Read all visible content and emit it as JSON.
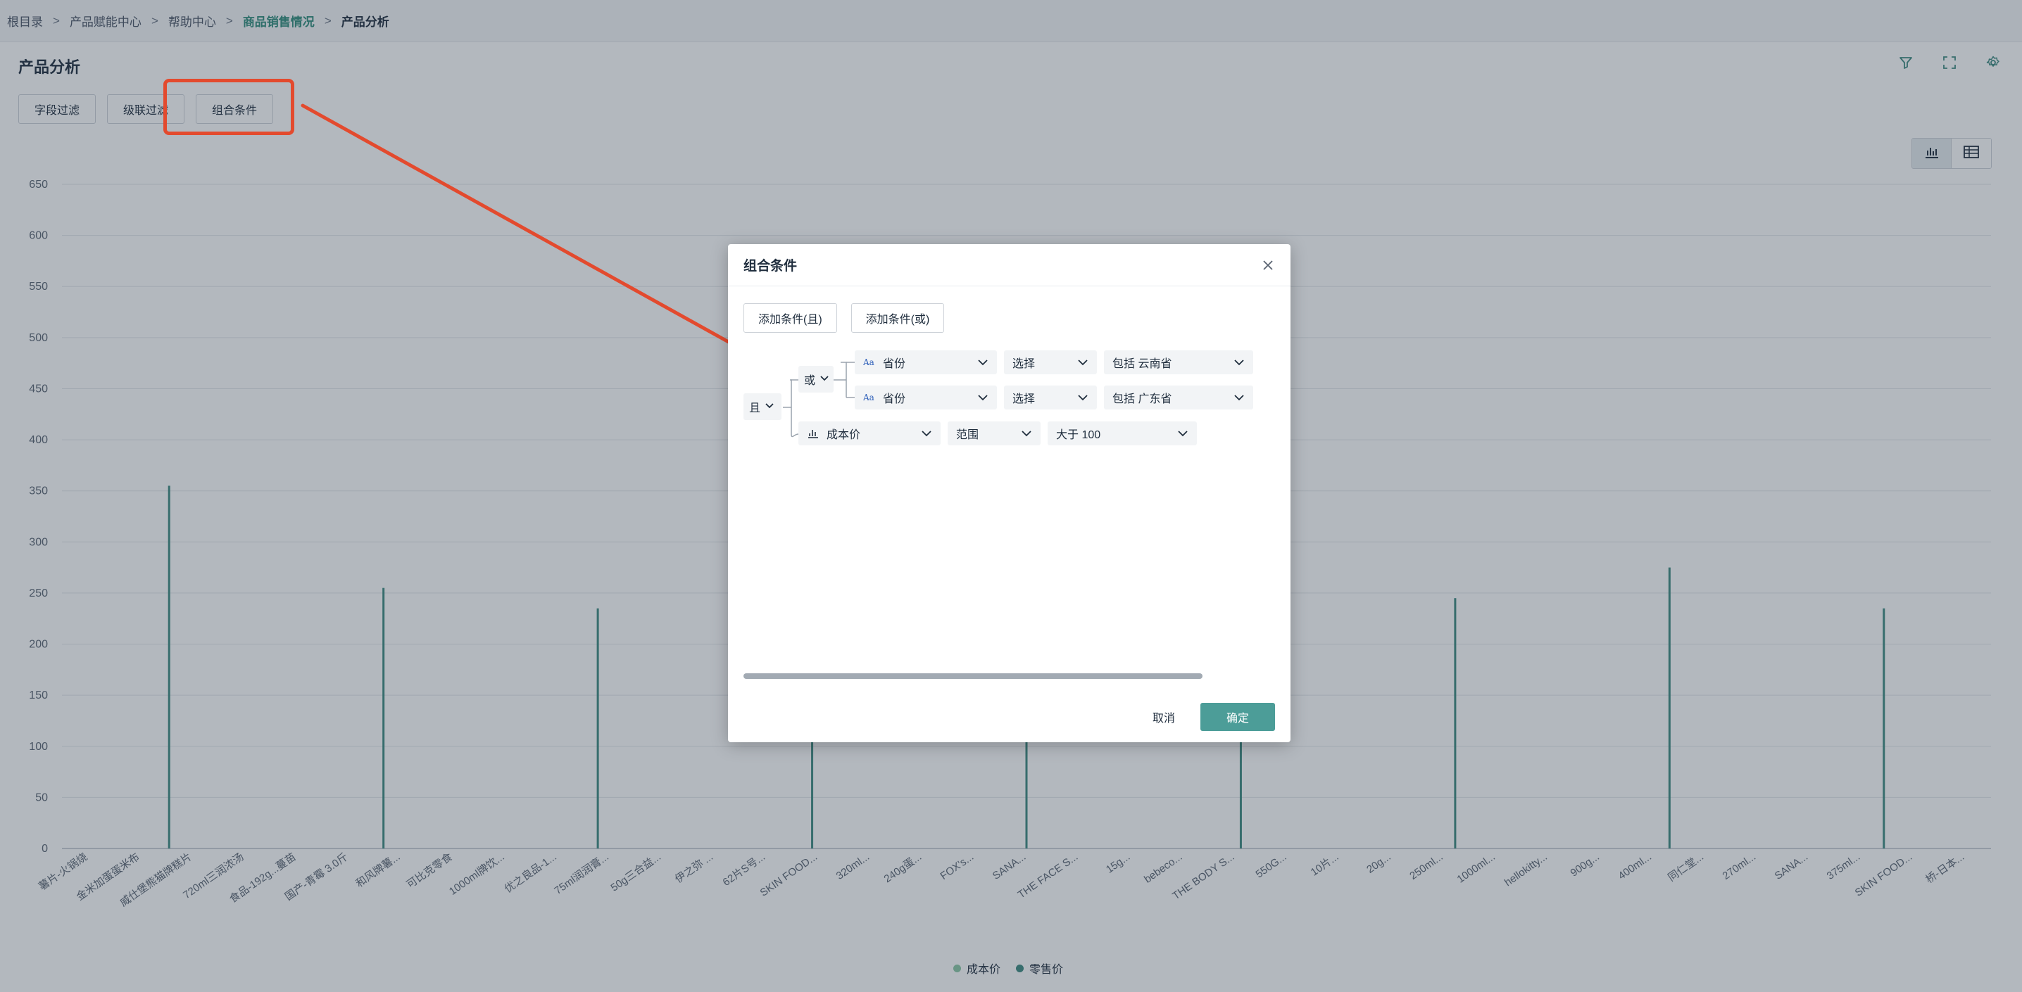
{
  "breadcrumb": [
    "根目录",
    "产品赋能中心",
    "帮助中心",
    "商品销售情况",
    "产品分析"
  ],
  "page": {
    "title": "产品分析"
  },
  "filter_tabs": [
    "字段过滤",
    "级联过滤",
    "组合条件"
  ],
  "icons": {
    "filter": "filter-icon",
    "fullscreen": "fullscreen-icon",
    "settings": "gear-icon",
    "chart_view": "bar-chart-icon",
    "table_view": "table-icon",
    "close": "close-icon",
    "text_field": "text-field-icon",
    "numeric_field": "numeric-field-icon",
    "chevron": "chevron-down-icon"
  },
  "colors": {
    "accent": "#4c9d98",
    "series_cost": "#8cc9a6",
    "series_retail": "#3e8a80",
    "highlight": "#e34a2e"
  },
  "chart_data": {
    "type": "bar",
    "series": [
      {
        "name": "成本价",
        "values": []
      },
      {
        "name": "零售价",
        "values": [
          355,
          255,
          235,
          205,
          330,
          275,
          245,
          275,
          235
        ]
      }
    ],
    "ylim": [
      0,
      650
    ],
    "yticks": [
      0,
      50,
      100,
      150,
      200,
      250,
      300,
      350,
      400,
      450,
      500,
      550,
      600,
      650
    ],
    "x_tick_labels": [
      "薯片-火锅烧",
      "金米加蛋蛋米布",
      "威仕堡熊猫牌糕片",
      "720ml三润浓汤",
      "食品-192g...蔓苗",
      "国产-青霉 3.0斤",
      "和风牌薯...",
      "可比克零食",
      "1000ml牌饮...",
      "优之良品-1...",
      "75ml润润膏...",
      "50g三合益...",
      "伊之弥 ...",
      "62片S号...",
      "SKIN FOOD...",
      "320ml...",
      "240g蛋...",
      "FOX's...",
      "SANA...",
      "THE FACE S...",
      "15g...",
      "bebeco...",
      "THE BODY S...",
      "550G...",
      "10片...",
      "20g...",
      "250ml...",
      "1000ml...",
      "hellokitty...",
      "900g...",
      "400ml...",
      "同仁堂...",
      "270ml...",
      "SANA...",
      "375ml...",
      "SKIN FOOD...",
      "桥-日本..."
    ],
    "legend_position": "bottom-center",
    "grid": true
  },
  "modal": {
    "title": "组合条件",
    "add_and": "添加条件(且)",
    "add_or": "添加条件(或)",
    "root_logic": "且",
    "group_logic": "或",
    "conditions": [
      {
        "field": "省份",
        "operator": "选择",
        "value": "包括 云南省"
      },
      {
        "field": "省份",
        "operator": "选择",
        "value": "包括 广东省"
      },
      {
        "field": "成本价",
        "operator": "范围",
        "value": "大于 100"
      }
    ],
    "cancel": "取消",
    "confirm": "确定"
  }
}
